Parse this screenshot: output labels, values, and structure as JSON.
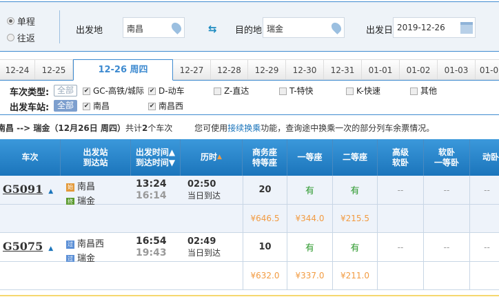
{
  "search": {
    "one_way": "单程",
    "round_trip": "往返",
    "from_label": "出发地",
    "from_value": "南昌",
    "to_label": "目的地",
    "to_value": "瑞金",
    "date_label": "出发日",
    "date_value": "2019-12-26"
  },
  "date_tabs": [
    "12-24",
    "12-25",
    "12-26 周四",
    "12-27",
    "12-28",
    "12-29",
    "12-30",
    "12-31",
    "01-01",
    "01-02",
    "01-03",
    "01-0"
  ],
  "filters": {
    "type_label": "车次类型:",
    "station_label": "出发车站:",
    "all": "全部",
    "types": [
      {
        "label": "GC-高铁/城际",
        "checked": true
      },
      {
        "label": "D-动车",
        "checked": true
      },
      {
        "label": "Z-直达",
        "checked": false
      },
      {
        "label": "T-特快",
        "checked": false
      },
      {
        "label": "K-快速",
        "checked": false
      },
      {
        "label": "其他",
        "checked": false
      }
    ],
    "stations": [
      {
        "label": "南昌",
        "checked": true
      },
      {
        "label": "南昌西",
        "checked": true
      }
    ]
  },
  "info": {
    "route": "南昌 --> 瑞金（12月26日 周四）",
    "count_pre": "共计",
    "count": "2",
    "count_post": "个车次",
    "tip_pre": "您可使用",
    "tip_link": "接续换乘",
    "tip_post": "功能，查询途中换乘一次的部分列车余票情况。"
  },
  "headers": {
    "train": "车次",
    "st1": "出发站",
    "st2": "到达站",
    "t1": "出发时间▲",
    "t2": "到达时间▼",
    "dur": "历时",
    "sw1": "商务座",
    "sw2": "特等座",
    "first": "一等座",
    "second": "二等座",
    "gr1": "高级",
    "gr2": "软卧",
    "rw1": "软卧",
    "rw2": "一等卧",
    "dw": "动卧"
  },
  "colors": {
    "accent": "#1b75bb",
    "price": "#f29b41",
    "available": "#2e9a2e"
  },
  "trains": [
    {
      "no": "G5091",
      "from_tag": "始",
      "from": "南昌",
      "to_tag": "终",
      "to": "瑞金",
      "dep": "13:24",
      "arr": "16:14",
      "dur": "02:50",
      "arrive_note": "当日到达",
      "business": "20",
      "first": "有",
      "second": "有",
      "gr": "--",
      "rw": "--",
      "dw": "--",
      "p_business": "¥646.5",
      "p_first": "¥344.0",
      "p_second": "¥215.5"
    },
    {
      "no": "G5075",
      "from_tag": "过",
      "from": "南昌西",
      "to_tag": "过",
      "to": "瑞金",
      "dep": "16:54",
      "arr": "19:43",
      "dur": "02:49",
      "arrive_note": "当日到达",
      "business": "10",
      "first": "有",
      "second": "有",
      "gr": "--",
      "rw": "--",
      "dw": "--",
      "p_business": "¥632.0",
      "p_first": "¥337.0",
      "p_second": "¥211.0"
    }
  ]
}
